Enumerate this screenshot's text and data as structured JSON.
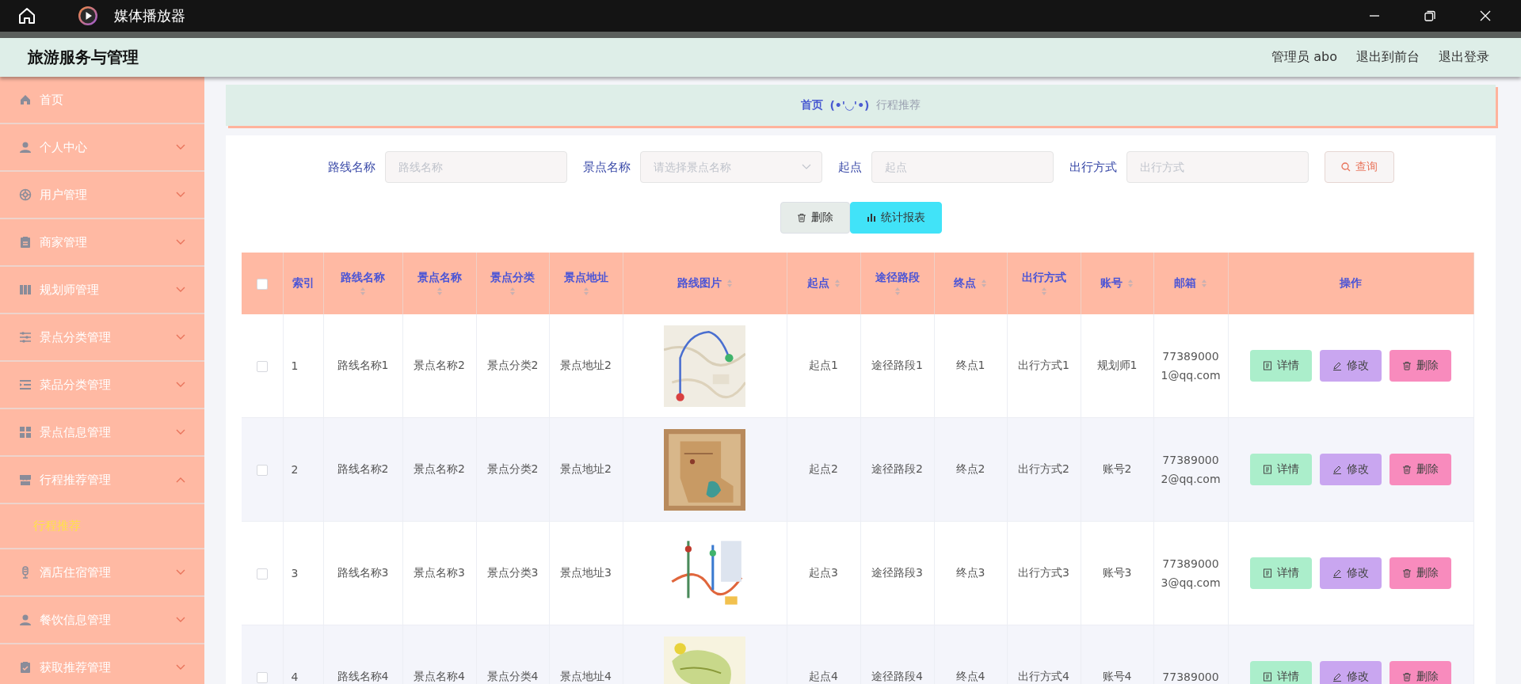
{
  "window": {
    "title": "媒体播放器"
  },
  "app": {
    "title": "旅游服务与管理",
    "user": "管理员 abo",
    "links": [
      "退出到前台",
      "退出登录"
    ]
  },
  "sidebar": {
    "items": [
      {
        "label": "首页",
        "kind": "home"
      },
      {
        "label": "个人中心",
        "kind": "person",
        "expanded": false
      },
      {
        "label": "用户管理",
        "kind": "target",
        "expanded": false
      },
      {
        "label": "商家管理",
        "kind": "clipboard",
        "expanded": false
      },
      {
        "label": "规划师管理",
        "kind": "books",
        "expanded": false
      },
      {
        "label": "景点分类管理",
        "kind": "sliders",
        "expanded": false
      },
      {
        "label": "菜品分类管理",
        "kind": "list",
        "expanded": false
      },
      {
        "label": "景点信息管理",
        "kind": "grid",
        "expanded": false
      },
      {
        "label": "行程推荐管理",
        "kind": "store",
        "expanded": true,
        "children": [
          {
            "label": "行程推荐",
            "selected": true
          }
        ]
      },
      {
        "label": "酒店住宿管理",
        "kind": "mic",
        "expanded": false
      },
      {
        "label": "餐饮信息管理",
        "kind": "person",
        "expanded": false
      },
      {
        "label": "获取推荐管理",
        "kind": "check",
        "expanded": false
      }
    ]
  },
  "breadcrumb": {
    "home": "首页",
    "face": "(•'◡'•)",
    "current": "行程推荐"
  },
  "search": {
    "fields": [
      {
        "label": "路线名称",
        "placeholder": "路线名称",
        "kind": "text"
      },
      {
        "label": "景点名称",
        "placeholder": "请选择景点名称",
        "kind": "select"
      },
      {
        "label": "起点",
        "placeholder": "起点",
        "kind": "text"
      },
      {
        "label": "出行方式",
        "placeholder": "出行方式",
        "kind": "text"
      }
    ],
    "button": "查询"
  },
  "toolbar": [
    {
      "label": "删除",
      "kind": "delete"
    },
    {
      "label": "统计报表",
      "kind": "report"
    }
  ],
  "table": {
    "header_checked": false,
    "columns": [
      {
        "label": "索引",
        "sortable": false
      },
      {
        "label": "路线名称",
        "sortable": true
      },
      {
        "label": "景点名称",
        "sortable": true
      },
      {
        "label": "景点分类",
        "sortable": true
      },
      {
        "label": "景点地址",
        "sortable": true
      },
      {
        "label": "路线图片",
        "sortable": true
      },
      {
        "label": "起点",
        "sortable": true
      },
      {
        "label": "途径路段",
        "sortable": true
      },
      {
        "label": "终点",
        "sortable": true
      },
      {
        "label": "出行方式",
        "sortable": true
      },
      {
        "label": "账号",
        "sortable": true
      },
      {
        "label": "邮箱",
        "sortable": true
      },
      {
        "label": "操作",
        "sortable": false
      }
    ],
    "rows": [
      {
        "checked": false,
        "cells": [
          "1",
          "路线名称1",
          "景点名称2",
          "景点分类2",
          "景点地址2"
        ],
        "image": {
          "kind": "picture"
        },
        "cells2": [
          "起点1",
          "途径路段1",
          "终点1",
          "出行方式1",
          "规划师1",
          "773890001@qq.com"
        ],
        "actions": [
          {
            "label": "详情",
            "kind": "detail"
          },
          {
            "label": "修改",
            "kind": "edit"
          },
          {
            "label": "删除",
            "kind": "delete"
          }
        ]
      },
      {
        "checked": false,
        "cells": [
          "2",
          "路线名称2",
          "景点名称2",
          "景点分类2",
          "景点地址2"
        ],
        "image": {
          "kind": "picture"
        },
        "cells2": [
          "起点2",
          "途径路段2",
          "终点2",
          "出行方式2",
          "账号2",
          "773890002@qq.com"
        ],
        "actions": [
          {
            "label": "详情",
            "kind": "detail"
          },
          {
            "label": "修改",
            "kind": "edit"
          },
          {
            "label": "删除",
            "kind": "delete"
          }
        ]
      },
      {
        "checked": false,
        "cells": [
          "3",
          "路线名称3",
          "景点名称3",
          "景点分类3",
          "景点地址3"
        ],
        "image": {
          "kind": "picture"
        },
        "cells2": [
          "起点3",
          "途径路段3",
          "终点3",
          "出行方式3",
          "账号3",
          "773890003@qq.com"
        ],
        "actions": [
          {
            "label": "详情",
            "kind": "detail"
          },
          {
            "label": "修改",
            "kind": "edit"
          },
          {
            "label": "删除",
            "kind": "delete"
          }
        ]
      },
      {
        "checked": false,
        "cells": [
          "4",
          "路线名称4",
          "景点名称4",
          "景点分类4",
          "景点地址4"
        ],
        "image": {
          "kind": "picture"
        },
        "cells2": [
          "起点4",
          "途径路段4",
          "终点4",
          "出行方式4",
          "账号4",
          "77389000"
        ],
        "actions": [
          {
            "label": "详情",
            "kind": "detail"
          },
          {
            "label": "修改",
            "kind": "edit"
          },
          {
            "label": "删除",
            "kind": "delete"
          }
        ]
      }
    ]
  }
}
